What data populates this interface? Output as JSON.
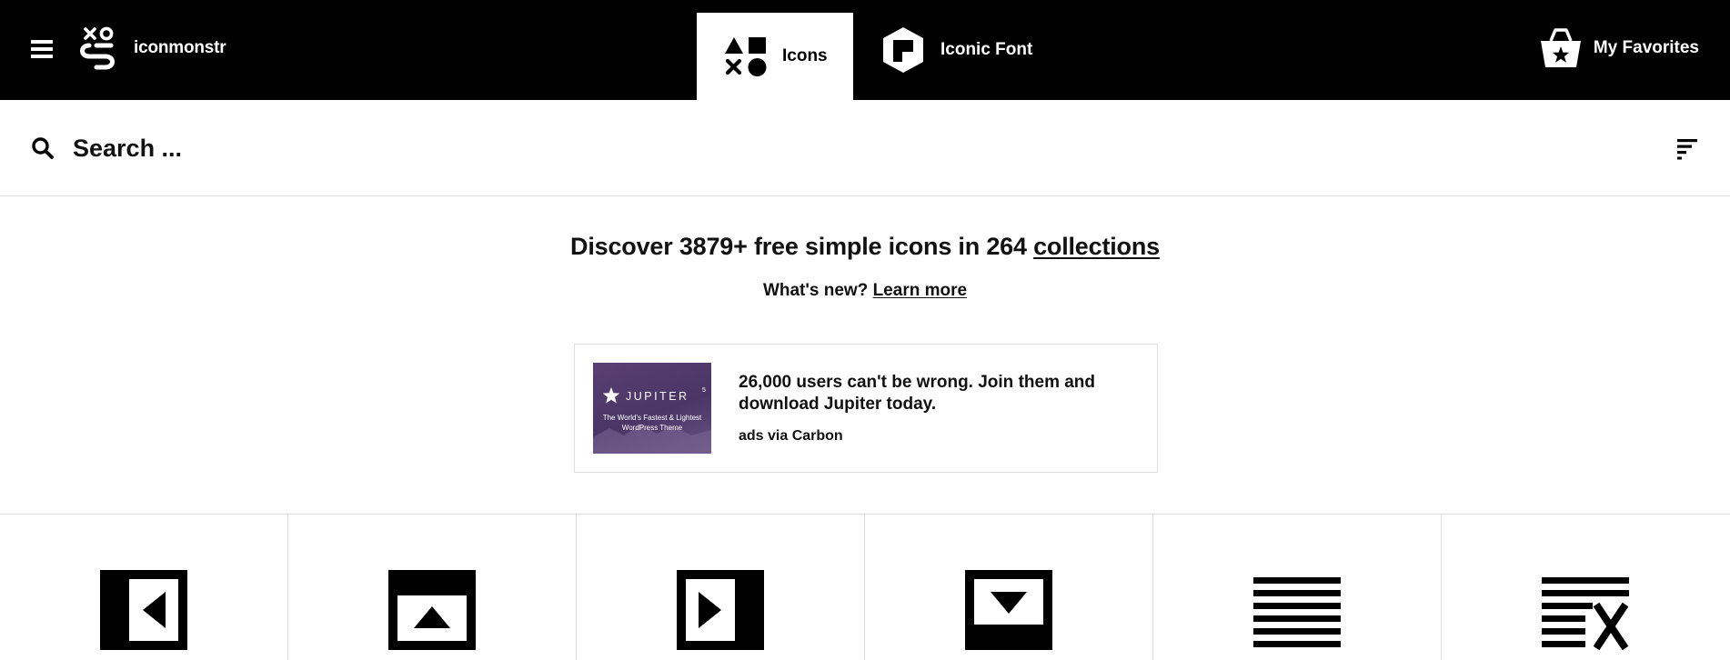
{
  "header": {
    "menu_icon": "hamburger-icon",
    "logo_text": "iconmonstr",
    "tabs": [
      {
        "label": "Icons",
        "icon": "shapes-icon",
        "active": true
      },
      {
        "label": "Iconic Font",
        "icon": "font-hexagon-icon",
        "active": false
      }
    ],
    "favorites_label": "My Favorites",
    "favorites_icon": "basket-star-icon"
  },
  "search": {
    "placeholder": "Search ...",
    "icon": "search-icon",
    "filter_icon": "filter-icon"
  },
  "intro": {
    "headline_prefix": "Discover 3879+ free simple icons in 264",
    "headline_link": "collections",
    "whats_new": "What's new?",
    "learn_more": "Learn more"
  },
  "ad": {
    "image_brand": "JUPITER",
    "image_brand_sup": "5",
    "image_tagline_1": "The World's Fastest & Lightest",
    "image_tagline_2": "WordPress Theme",
    "text": "26,000 users can't be wrong. Join them and download Jupiter today.",
    "via": "ads via Carbon"
  },
  "icon_grid": [
    {
      "icon": "panel-left-arrow-icon"
    },
    {
      "icon": "panel-up-arrow-icon"
    },
    {
      "icon": "panel-right-arrow-icon"
    },
    {
      "icon": "panel-down-arrow-icon"
    },
    {
      "icon": "text-lines-icon"
    },
    {
      "icon": "text-lines-delete-icon"
    }
  ],
  "colors": {
    "header_bg": "#000000",
    "accent_text": "#111111",
    "border": "#dddddd",
    "ad_image_bg": "#4a3566"
  }
}
